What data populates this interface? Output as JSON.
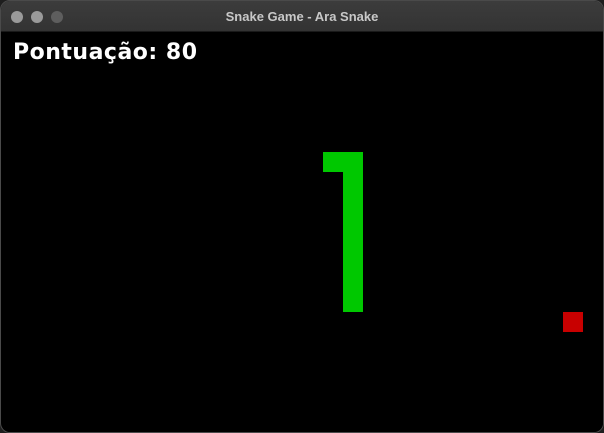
{
  "window": {
    "title": "Snake Game - Ara Snake"
  },
  "hud": {
    "score_text": "Pontuação: 80"
  },
  "colors": {
    "snake": "#00c800",
    "food": "#c80000",
    "board_background": "#000000"
  }
}
